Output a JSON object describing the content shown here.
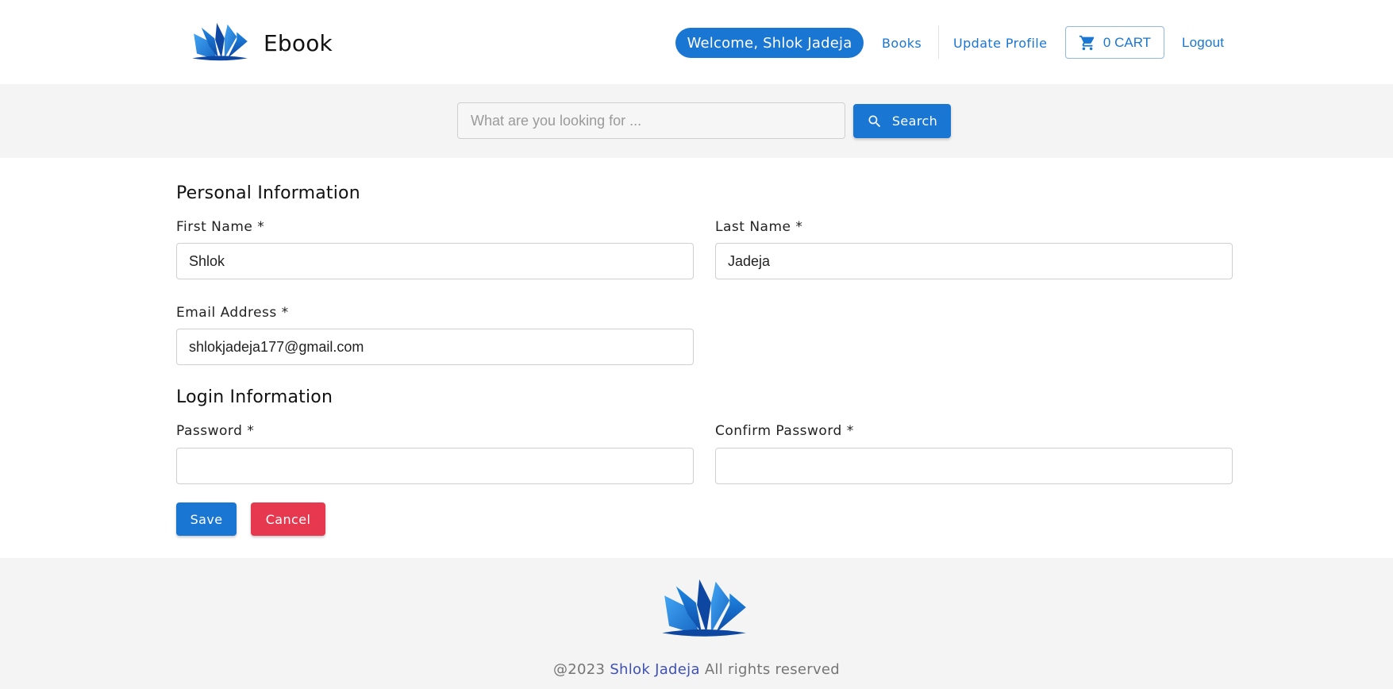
{
  "brand": {
    "name": "Ebook",
    "logo_icon": "open-book-logo-icon"
  },
  "header": {
    "welcome": "Welcome, Shlok Jadeja",
    "nav": {
      "books": "Books",
      "update_profile": "Update Profile",
      "logout": "Logout"
    },
    "cart": {
      "label": "0 CART",
      "icon": "cart-icon"
    }
  },
  "search": {
    "placeholder": "What are you looking for ...",
    "button": "Search",
    "icon": "search-icon"
  },
  "form": {
    "personal_title": "Personal Information",
    "first_name": {
      "label": "First Name *",
      "value": "Shlok"
    },
    "last_name": {
      "label": "Last Name *",
      "value": "Jadeja"
    },
    "email": {
      "label": "Email Address *",
      "value": "shlokjadeja177@gmail.com"
    },
    "login_title": "Login Information",
    "password": {
      "label": "Password *",
      "value": ""
    },
    "confirm_password": {
      "label": "Confirm Password *",
      "value": ""
    },
    "save": "Save",
    "cancel": "Cancel"
  },
  "footer": {
    "prefix": "@2023",
    "owner": "Shlok Jadeja",
    "suffix": "All rights reserved"
  },
  "colors": {
    "primary": "#1976d2",
    "danger": "#e63950",
    "band": "#f4f4f4",
    "footer_link": "#3f51b5"
  }
}
